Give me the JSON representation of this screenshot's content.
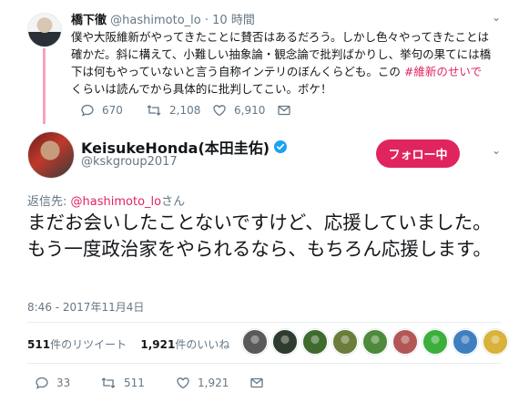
{
  "quoted_tweet": {
    "name": "橋下徹",
    "handle": "@hashimoto_lo",
    "time": "10 時間",
    "text_before": "僕や大阪維新がやってきたことに賛否はあるだろう。しかし色々やってきたことは確かだ。斜に構えて、小難しい抽象論・観念論で批判ばかりし、挙句の果てには橋下は何もやっていないと言う自称インテリのぼんくらども。この",
    "hashtag": "#維新のせいで",
    "text_after": "くらいは読んでから具体的に批判してこい。ボケ！",
    "reply_count": "670",
    "retweet_count": "2,108",
    "like_count": "6,910"
  },
  "main_tweet": {
    "name": "KeisukeHonda(本田圭佑)",
    "handle": "@kskgroup2017",
    "follow_label": "フォロー中",
    "reply_to_prefix": "返信先:",
    "reply_to_mention": "@hashimoto_lo",
    "reply_to_suffix": "さん",
    "text": "まだお会いしたことないですけど、応援していました。もう一度政治家をやられるなら、もちろん応援します。",
    "timestamp": "8:46 - 2017年11月4日",
    "retweets_num": "511",
    "retweets_label": "件のリツイート",
    "likes_num": "1,921",
    "likes_label": "件のいいね",
    "reply_count": "33",
    "retweet_count": "511",
    "like_count": "1,921"
  },
  "colors": {
    "accent": "#e0245e",
    "muted": "#657786",
    "verified": "#1da1f2",
    "thread_line": "#f5a3bf"
  },
  "liker_avatars": [
    {
      "color": "#5a5a5a"
    },
    {
      "color": "#2e3b2e"
    },
    {
      "color": "#3f6b2f"
    },
    {
      "color": "#6a7d3a"
    },
    {
      "color": "#4f8a3c"
    },
    {
      "color": "#b35656"
    },
    {
      "color": "#3cae3c"
    },
    {
      "color": "#3f7fc0"
    },
    {
      "color": "#d8b23a"
    }
  ]
}
